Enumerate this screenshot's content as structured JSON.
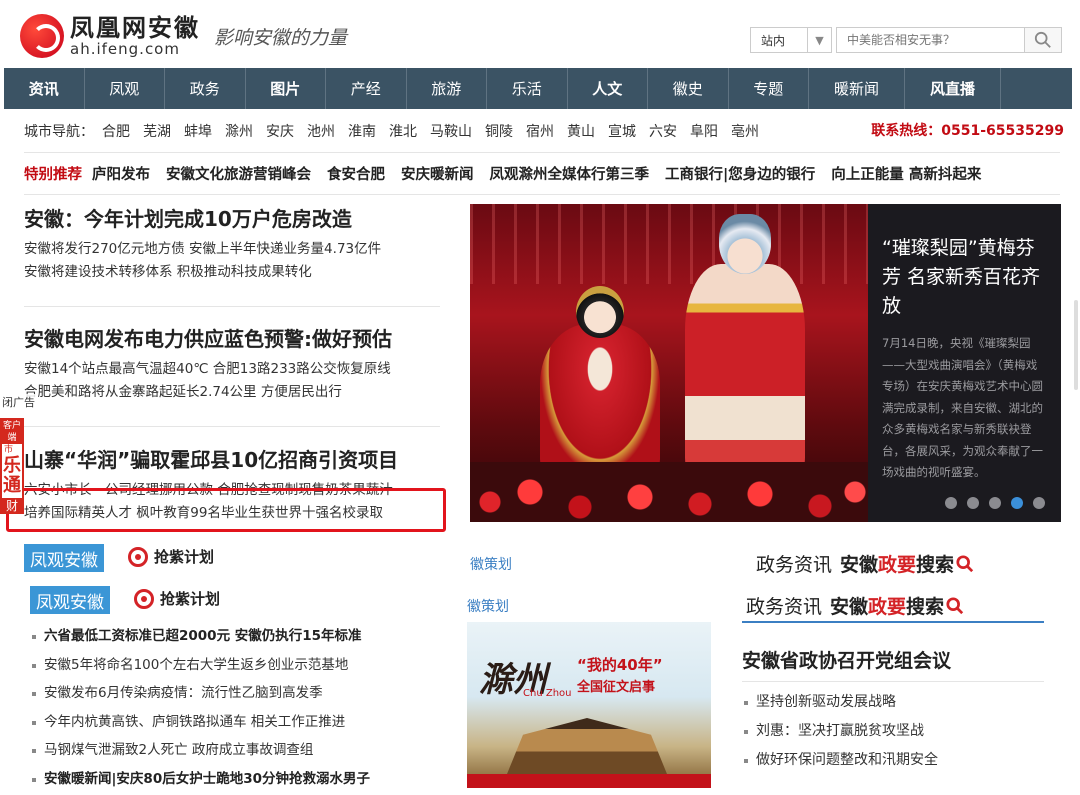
{
  "header": {
    "logo_cn": "凤凰网安徽",
    "logo_url": "ah.ifeng.com",
    "slogan": "影响安徽的力量",
    "search_scope": "站内",
    "search_placeholder": "中美能否相安无事？"
  },
  "nav": [
    {
      "label": "资讯",
      "bold": true
    },
    {
      "label": "凤观",
      "bold": false
    },
    {
      "label": "政务",
      "bold": false
    },
    {
      "label": "图片",
      "bold": true
    },
    {
      "label": "产经",
      "bold": false
    },
    {
      "label": "旅游",
      "bold": false
    },
    {
      "label": "乐活",
      "bold": false
    },
    {
      "label": "人文",
      "bold": true
    },
    {
      "label": "徽史",
      "bold": false
    },
    {
      "label": "专题",
      "bold": false
    },
    {
      "label": "暖新闻",
      "bold": false
    },
    {
      "label": "风直播",
      "bold": true
    }
  ],
  "city_nav": {
    "label": "城市导航：",
    "cities": [
      "合肥",
      "芜湖",
      "蚌埠",
      "滁州",
      "安庆",
      "池州",
      "淮南",
      "淮北",
      "马鞍山",
      "铜陵",
      "宿州",
      "黄山",
      "宣城",
      "六安",
      "阜阳",
      "亳州"
    ],
    "hotline": "联系热线：0551-65535299"
  },
  "recommend": {
    "label": "特别推荐",
    "items": [
      "庐阳发布",
      "安徽文化旅游营销峰会",
      "食安合肥",
      "安庆暖新闻",
      "凤观滁州全媒体行第三季",
      "工商银行|您身边的银行",
      "向上正能量 高新抖起来"
    ]
  },
  "news": [
    {
      "title": "安徽：今年计划完成10万户危房改造",
      "lines": [
        "安徽将发行270亿元地方债 安徽上半年快递业务量4.73亿件",
        "安徽将建设技术转移体系 积极推动科技成果转化"
      ]
    },
    {
      "title": "安徽电网发布电力供应蓝色预警:做好预估",
      "lines": [
        "安徽14个站点最高气温超40℃ 合肥13路233路公交恢复原线",
        "合肥美和路将从金寨路起延长2.74公里 方便居民出行"
      ]
    },
    {
      "title": "山寨“华润”骗取霍邱县10亿招商引资项目",
      "lines": [
        "六安小市长一公司经理挪用公款 合肥抢查现制现售奶茶果蔬汁",
        "培养国际精英人才 枫叶教育99名毕业生获世界十强名校录取"
      ]
    }
  ],
  "ad": {
    "close": "闭广告",
    "t1": "客户端",
    "t2": "市",
    "t3": "乐通",
    "t4": "财"
  },
  "carousel": {
    "title": "“璀璨梨园”黄梅芬芳 名家新秀百花齐放",
    "desc": "7月14日晚，央视《璀璨梨园——大型戏曲演唱会》（黄梅戏专场）在安庆黄梅戏艺术中心圆满完成录制，来自安徽、湖北的众多黄梅戏名家与新秀联袂登台，各展风采，为观众奉献了一场戏曲的视听盛宴。",
    "active_index": 3,
    "slides": 5
  },
  "fengguan": {
    "tag": "凤观安徽",
    "qiangzi": "抢紫计划",
    "items": [
      {
        "text": "六省最低工资标准已超2000元 安徽仍执行15年标准",
        "bold": true
      },
      {
        "text": "安徽5年将命名100个左右大学生返乡创业示范基地",
        "bold": false
      },
      {
        "text": "安徽发布6月传染病疫情：流行性乙脑到高发季",
        "bold": false
      },
      {
        "text": "今年内杭黄高铁、庐铜铁路拟通车 相关工作正推进",
        "bold": false
      },
      {
        "text": "马钢煤气泄漏致2人死亡 政府成立事故调查组",
        "bold": false
      },
      {
        "text": "安徽暖新闻|安庆80后女护士跪地30分钟抢救溺水男子",
        "bold": true
      }
    ]
  },
  "hui": {
    "label": "徽策划",
    "poster_title": "滁州",
    "poster_pinyin": "Chu Zhou",
    "poster_sub1": "“我的40年”",
    "poster_sub2": "全国征文启事"
  },
  "gov": {
    "tab": "政务资讯",
    "search_brand_a": "安徽",
    "search_brand_b": "政要",
    "search_brand_c": "搜索",
    "headline": "安徽省政协召开党组会议",
    "items": [
      "坚持创新驱动发展战略",
      "刘惠：坚决打赢脱贫攻坚战",
      "做好环保问题整改和汛期安全"
    ]
  }
}
